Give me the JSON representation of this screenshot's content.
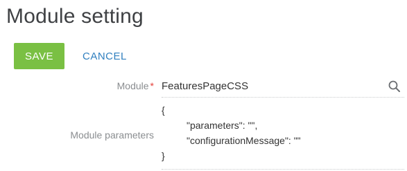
{
  "page": {
    "title": "Module setting"
  },
  "toolbar": {
    "save_label": "SAVE",
    "cancel_label": "CANCEL"
  },
  "fields": {
    "module": {
      "label": "Module",
      "required_marker": "*",
      "value": "FeaturesPageCSS",
      "icon": "search-icon"
    },
    "parameters": {
      "label": "Module parameters",
      "lines": [
        "{",
        "\"parameters\": \"\",",
        "\"configurationMessage\": \"\"",
        "}"
      ]
    }
  },
  "colors": {
    "save_bg": "#7ac043",
    "cancel_text": "#2f7fbf",
    "required": "#e5413b",
    "label_text": "#8a8d90",
    "title_text": "#3f4144"
  }
}
